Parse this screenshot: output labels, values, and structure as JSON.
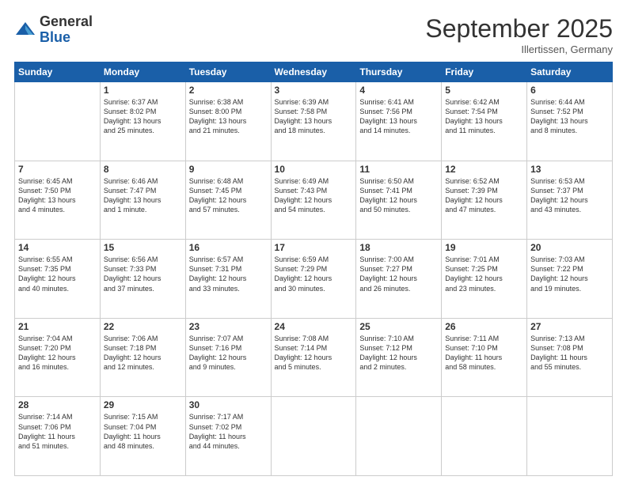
{
  "logo": {
    "general": "General",
    "blue": "Blue"
  },
  "header": {
    "month": "September 2025",
    "location": "Illertissen, Germany"
  },
  "weekdays": [
    "Sunday",
    "Monday",
    "Tuesday",
    "Wednesday",
    "Thursday",
    "Friday",
    "Saturday"
  ],
  "weeks": [
    [
      {
        "day": "",
        "text": ""
      },
      {
        "day": "1",
        "text": "Sunrise: 6:37 AM\nSunset: 8:02 PM\nDaylight: 13 hours\nand 25 minutes."
      },
      {
        "day": "2",
        "text": "Sunrise: 6:38 AM\nSunset: 8:00 PM\nDaylight: 13 hours\nand 21 minutes."
      },
      {
        "day": "3",
        "text": "Sunrise: 6:39 AM\nSunset: 7:58 PM\nDaylight: 13 hours\nand 18 minutes."
      },
      {
        "day": "4",
        "text": "Sunrise: 6:41 AM\nSunset: 7:56 PM\nDaylight: 13 hours\nand 14 minutes."
      },
      {
        "day": "5",
        "text": "Sunrise: 6:42 AM\nSunset: 7:54 PM\nDaylight: 13 hours\nand 11 minutes."
      },
      {
        "day": "6",
        "text": "Sunrise: 6:44 AM\nSunset: 7:52 PM\nDaylight: 13 hours\nand 8 minutes."
      }
    ],
    [
      {
        "day": "7",
        "text": "Sunrise: 6:45 AM\nSunset: 7:50 PM\nDaylight: 13 hours\nand 4 minutes."
      },
      {
        "day": "8",
        "text": "Sunrise: 6:46 AM\nSunset: 7:47 PM\nDaylight: 13 hours\nand 1 minute."
      },
      {
        "day": "9",
        "text": "Sunrise: 6:48 AM\nSunset: 7:45 PM\nDaylight: 12 hours\nand 57 minutes."
      },
      {
        "day": "10",
        "text": "Sunrise: 6:49 AM\nSunset: 7:43 PM\nDaylight: 12 hours\nand 54 minutes."
      },
      {
        "day": "11",
        "text": "Sunrise: 6:50 AM\nSunset: 7:41 PM\nDaylight: 12 hours\nand 50 minutes."
      },
      {
        "day": "12",
        "text": "Sunrise: 6:52 AM\nSunset: 7:39 PM\nDaylight: 12 hours\nand 47 minutes."
      },
      {
        "day": "13",
        "text": "Sunrise: 6:53 AM\nSunset: 7:37 PM\nDaylight: 12 hours\nand 43 minutes."
      }
    ],
    [
      {
        "day": "14",
        "text": "Sunrise: 6:55 AM\nSunset: 7:35 PM\nDaylight: 12 hours\nand 40 minutes."
      },
      {
        "day": "15",
        "text": "Sunrise: 6:56 AM\nSunset: 7:33 PM\nDaylight: 12 hours\nand 37 minutes."
      },
      {
        "day": "16",
        "text": "Sunrise: 6:57 AM\nSunset: 7:31 PM\nDaylight: 12 hours\nand 33 minutes."
      },
      {
        "day": "17",
        "text": "Sunrise: 6:59 AM\nSunset: 7:29 PM\nDaylight: 12 hours\nand 30 minutes."
      },
      {
        "day": "18",
        "text": "Sunrise: 7:00 AM\nSunset: 7:27 PM\nDaylight: 12 hours\nand 26 minutes."
      },
      {
        "day": "19",
        "text": "Sunrise: 7:01 AM\nSunset: 7:25 PM\nDaylight: 12 hours\nand 23 minutes."
      },
      {
        "day": "20",
        "text": "Sunrise: 7:03 AM\nSunset: 7:22 PM\nDaylight: 12 hours\nand 19 minutes."
      }
    ],
    [
      {
        "day": "21",
        "text": "Sunrise: 7:04 AM\nSunset: 7:20 PM\nDaylight: 12 hours\nand 16 minutes."
      },
      {
        "day": "22",
        "text": "Sunrise: 7:06 AM\nSunset: 7:18 PM\nDaylight: 12 hours\nand 12 minutes."
      },
      {
        "day": "23",
        "text": "Sunrise: 7:07 AM\nSunset: 7:16 PM\nDaylight: 12 hours\nand 9 minutes."
      },
      {
        "day": "24",
        "text": "Sunrise: 7:08 AM\nSunset: 7:14 PM\nDaylight: 12 hours\nand 5 minutes."
      },
      {
        "day": "25",
        "text": "Sunrise: 7:10 AM\nSunset: 7:12 PM\nDaylight: 12 hours\nand 2 minutes."
      },
      {
        "day": "26",
        "text": "Sunrise: 7:11 AM\nSunset: 7:10 PM\nDaylight: 11 hours\nand 58 minutes."
      },
      {
        "day": "27",
        "text": "Sunrise: 7:13 AM\nSunset: 7:08 PM\nDaylight: 11 hours\nand 55 minutes."
      }
    ],
    [
      {
        "day": "28",
        "text": "Sunrise: 7:14 AM\nSunset: 7:06 PM\nDaylight: 11 hours\nand 51 minutes."
      },
      {
        "day": "29",
        "text": "Sunrise: 7:15 AM\nSunset: 7:04 PM\nDaylight: 11 hours\nand 48 minutes."
      },
      {
        "day": "30",
        "text": "Sunrise: 7:17 AM\nSunset: 7:02 PM\nDaylight: 11 hours\nand 44 minutes."
      },
      {
        "day": "",
        "text": ""
      },
      {
        "day": "",
        "text": ""
      },
      {
        "day": "",
        "text": ""
      },
      {
        "day": "",
        "text": ""
      }
    ]
  ]
}
